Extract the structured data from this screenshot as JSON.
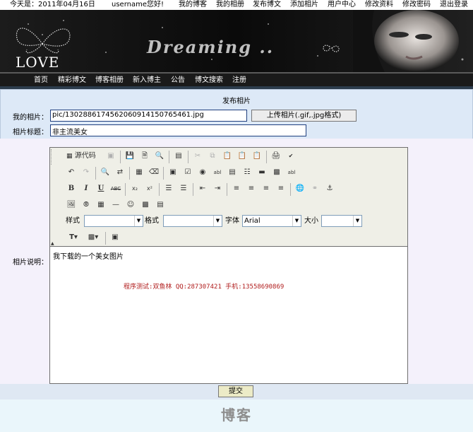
{
  "topbar": {
    "date_text": "今天是：2011年04月16日",
    "greeting": "username您好!",
    "links": [
      "我的博客",
      "我的相册",
      "发布博文",
      "添加相片",
      "用户中心",
      "修改资料",
      "修改密码",
      "退出登录"
    ]
  },
  "banner": {
    "love_text": "LOVE",
    "dreaming_text": "Dreaming .."
  },
  "nav": {
    "items": [
      "首页",
      "精彩博文",
      "博客相册",
      "新入博主",
      "公告",
      "博文搜索",
      "注册"
    ]
  },
  "form": {
    "title": "发布相片",
    "photo_label": "我的相片：",
    "photo_value": "pic/130288617456206091415076546​1.jpg",
    "upload_label": "上传相片(.gif,.jpg格式)",
    "title_label": "相片标题：",
    "title_value": "非主流美女",
    "desc_label": "相片说明：",
    "submit_label": "提交"
  },
  "editor": {
    "source_label": "源代码",
    "style_label": "样式",
    "format_label": "格式",
    "font_label": "字体",
    "font_value": "Arial",
    "size_label": "大小",
    "content_line1": "我下载的一个美女图片",
    "content_line2": "程序测试:双鱼林 QQ:287307421 手机:13558690869"
  },
  "footer": {
    "logo_text": "博客"
  },
  "colors": {
    "nav_bg": "#1a1a1a",
    "panel_bg": "#dde9f7",
    "editor_text_red": "#b01c1c"
  }
}
